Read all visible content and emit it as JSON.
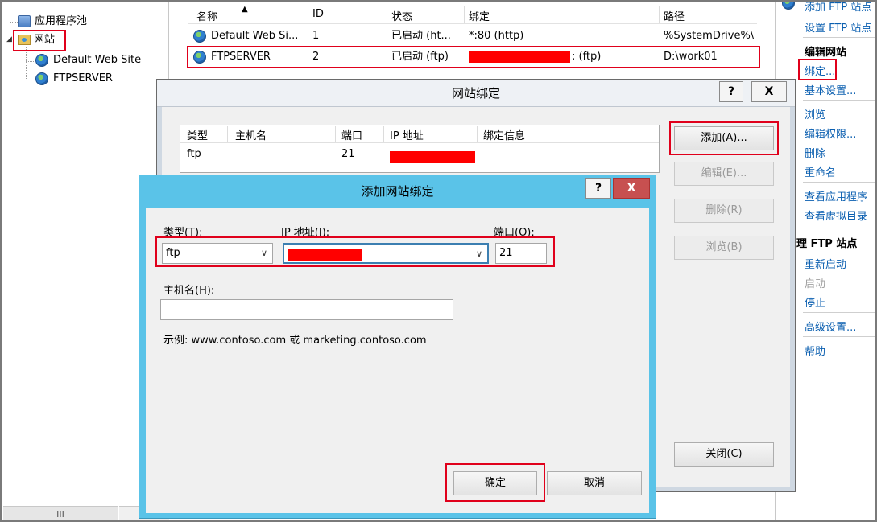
{
  "tree": {
    "server_label": "",
    "app_pools": "应用程序池",
    "sites": "网站",
    "site1": "Default Web Site",
    "site2": "FTPSERVER",
    "scroll_glyph": "III"
  },
  "list": {
    "headers": [
      "名称",
      "ID",
      "状态",
      "绑定",
      "路径"
    ],
    "rows": [
      {
        "name": "Default Web Si...",
        "id": "1",
        "status": "已启动 (ht...",
        "binding": "*:80 (http)",
        "path": "%SystemDrive%\\"
      },
      {
        "name": "FTPSERVER",
        "id": "2",
        "status": "已启动 (ftp)",
        "binding_suffix": ": (ftp)",
        "path": "D:\\work01"
      }
    ]
  },
  "actions": {
    "add_ftp": "添加 FTP 站点",
    "set_ftp": "设置 FTP 站点",
    "edit_site_head": "编辑网站",
    "bindings": "绑定...",
    "basic_settings": "基本设置...",
    "browse": "浏览",
    "edit_perms": "编辑权限...",
    "delete": "删除",
    "rename": "重命名",
    "view_apps": "查看应用程序",
    "view_vdirs": "查看虚拟目录",
    "manage_ftp_head": "理 FTP 站点",
    "restart": "重新启动",
    "start": "启动",
    "stop": "停止",
    "advanced": "高级设置...",
    "help": "帮助"
  },
  "bindings_dialog": {
    "title": "网站绑定",
    "help_btn": "?",
    "close_btn": "X",
    "columns": [
      "类型",
      "主机名",
      "端口",
      "IP 地址",
      "绑定信息"
    ],
    "row": {
      "type": "ftp",
      "host": "",
      "port": "21"
    },
    "add": "添加(A)...",
    "edit": "编辑(E)...",
    "remove": "删除(R)",
    "browse": "浏览(B)",
    "close": "关闭(C)"
  },
  "add_dialog": {
    "title": "添加网站绑定",
    "help_btn": "?",
    "close_btn": "X",
    "type_label": "类型(T):",
    "ip_label": "IP 地址(I):",
    "port_label": "端口(O):",
    "type_value": "ftp",
    "port_value": "21",
    "host_label": "主机名(H):",
    "host_value": "",
    "example": "示例: www.contoso.com 或 marketing.contoso.com",
    "ok": "确定",
    "cancel": "取消"
  },
  "colors": {
    "highlight_box": "#e0001b",
    "redaction": "#ff0000",
    "title_blue": "#5ac3e8",
    "link": "#0b5fb0"
  }
}
